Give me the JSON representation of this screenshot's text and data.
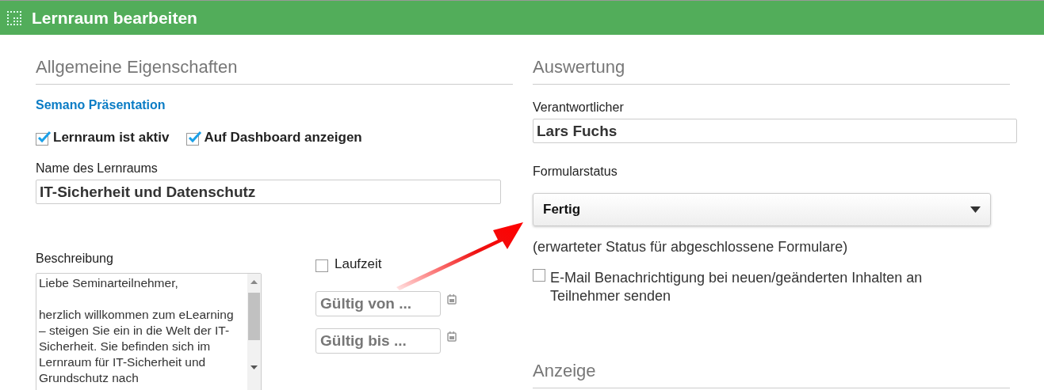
{
  "window": {
    "title": "Lernraum bearbeiten"
  },
  "general": {
    "heading": "Allgemeine Eigenschaften",
    "link": "Semano Präsentation",
    "checkboxes": [
      {
        "label": "Lernraum ist aktiv",
        "checked": true
      },
      {
        "label": "Auf Dashboard anzeigen",
        "checked": true
      }
    ],
    "name_label": "Name des Lernraums",
    "name_value": "IT-Sicherheit und Datenschutz",
    "description_label": "Beschreibung",
    "description_value": "Liebe Seminarteilnehmer,\n\nherzlich willkommen zum eLearning – steigen Sie ein in die Welt der IT-Sicherheit. Sie befinden sich im Lernraum für IT-Sicherheit und Grundschutz nach",
    "runtime": {
      "label": "Laufzeit",
      "checked": false
    },
    "date_fields": [
      {
        "placeholder": "Gültig von ..."
      },
      {
        "placeholder": "Gültig bis ..."
      }
    ]
  },
  "evaluation": {
    "heading": "Auswertung",
    "responsible_label": "Verantwortlicher",
    "responsible_value": "Lars Fuchs",
    "status_label": "Formularstatus",
    "status_value": "Fertig",
    "status_hint": "(erwarteter Status für abgeschlossene Formulare)",
    "email": {
      "label": "E-Mail Benachrichtigung bei neuen/geänderten Inhalten an Teilnehmer senden",
      "checked": false
    }
  },
  "display": {
    "heading": "Anzeige"
  }
}
